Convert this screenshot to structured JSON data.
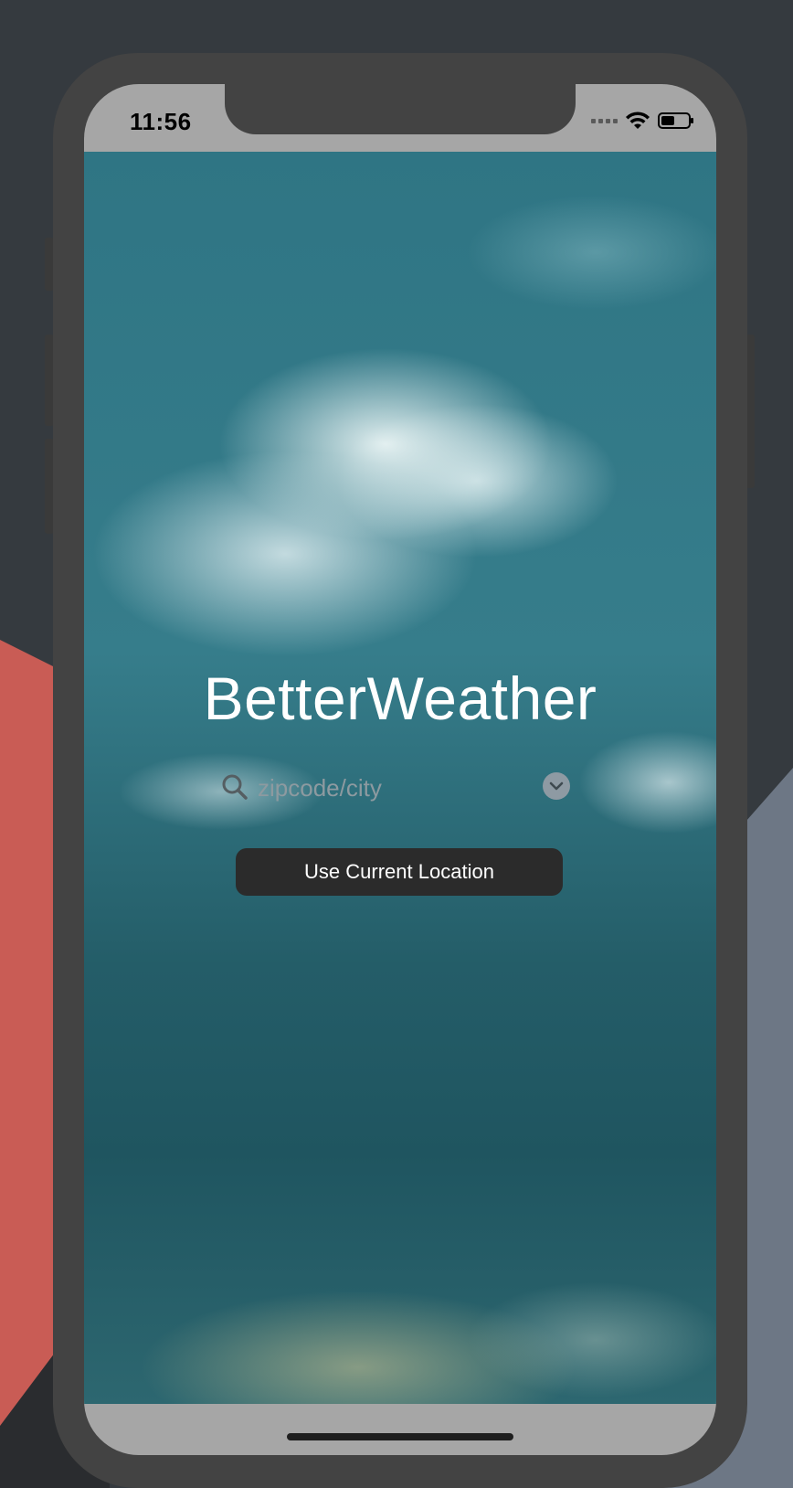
{
  "status_bar": {
    "time": "11:56",
    "icons": [
      "cellular-signal-icon",
      "wifi-icon",
      "battery-icon"
    ]
  },
  "app": {
    "title": "BetterWeather"
  },
  "search": {
    "placeholder": "zipcode/city",
    "value": "",
    "icon": "search-icon",
    "dropdown_icon": "chevron-down-icon"
  },
  "location_button": {
    "label": "Use Current Location"
  },
  "colors": {
    "background": "#353a3f",
    "sky_teal": "#367d8b",
    "button_bg": "#2b2b2b",
    "title_text": "#ffffff"
  }
}
